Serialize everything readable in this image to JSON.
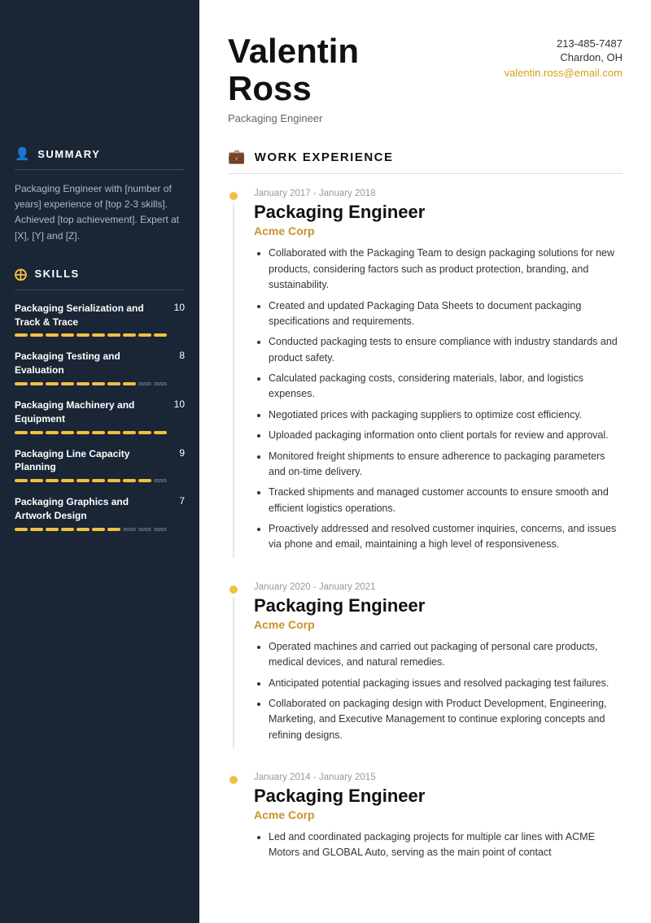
{
  "header": {
    "name_line1": "Valentin",
    "name_line2": "Ross",
    "subtitle": "Packaging Engineer",
    "phone": "213-485-7487",
    "location": "Chardon, OH",
    "email": "valentin.ross@email.com"
  },
  "sidebar": {
    "summary_title": "SUMMARY",
    "summary_icon": "👤",
    "summary_text": "Packaging Engineer with [number of years] experience of [top 2-3 skills]. Achieved [top achievement]. Expert at [X], [Y] and [Z].",
    "skills_title": "SKILLS",
    "skills_icon": "⊕",
    "skills": [
      {
        "name": "Packaging Serialization and Track & Trace",
        "score": 10,
        "filled": 10
      },
      {
        "name": "Packaging Testing and Evaluation",
        "score": 8,
        "filled": 8
      },
      {
        "name": "Packaging Machinery and Equipment",
        "score": 10,
        "filled": 10
      },
      {
        "name": "Packaging Line Capacity Planning",
        "score": 9,
        "filled": 9
      },
      {
        "name": "Packaging Graphics and Artwork Design",
        "score": 7,
        "filled": 7
      }
    ],
    "total_dots": 10
  },
  "work_experience": {
    "section_title": "WORK EXPERIENCE",
    "section_icon": "🗂",
    "entries": [
      {
        "date": "January 2017 - January 2018",
        "title": "Packaging Engineer",
        "company": "Acme Corp",
        "bullets": [
          "Collaborated with the Packaging Team to design packaging solutions for new products, considering factors such as product protection, branding, and sustainability.",
          "Created and updated Packaging Data Sheets to document packaging specifications and requirements.",
          "Conducted packaging tests to ensure compliance with industry standards and product safety.",
          "Calculated packaging costs, considering materials, labor, and logistics expenses.",
          "Negotiated prices with packaging suppliers to optimize cost efficiency.",
          "Uploaded packaging information onto client portals for review and approval.",
          "Monitored freight shipments to ensure adherence to packaging parameters and on-time delivery.",
          "Tracked shipments and managed customer accounts to ensure smooth and efficient logistics operations.",
          "Proactively addressed and resolved customer inquiries, concerns, and issues via phone and email, maintaining a high level of responsiveness."
        ]
      },
      {
        "date": "January 2020 - January 2021",
        "title": "Packaging Engineer",
        "company": "Acme Corp",
        "bullets": [
          "Operated machines and carried out packaging of personal care products, medical devices, and natural remedies.",
          "Anticipated potential packaging issues and resolved packaging test failures.",
          "Collaborated on packaging design with Product Development, Engineering, Marketing, and Executive Management to continue exploring concepts and refining designs."
        ]
      },
      {
        "date": "January 2014 - January 2015",
        "title": "Packaging Engineer",
        "company": "Acme Corp",
        "bullets": [
          "Led and coordinated packaging projects for multiple car lines with ACME Motors and GLOBAL Auto, serving as the main point of contact"
        ]
      }
    ]
  }
}
